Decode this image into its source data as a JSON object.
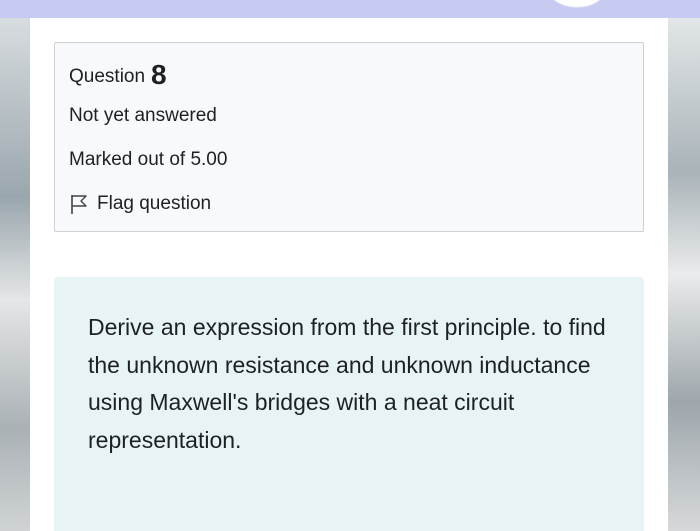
{
  "question": {
    "label": "Question",
    "number": "8",
    "status": "Not yet answered",
    "marks": "Marked out of 5.00",
    "flag_label": "Flag question",
    "flag_icon": "flag-outline-icon"
  },
  "prompt": {
    "text": "Derive an expression from the first principle. to find the unknown resistance and unknown inductance using Maxwell's bridges with a neat circuit representation."
  },
  "colors": {
    "top_bar": "#c7cbf2",
    "info_bg": "#f8f9fa",
    "prompt_bg": "#e7f3f5",
    "text": "#1d2125"
  }
}
